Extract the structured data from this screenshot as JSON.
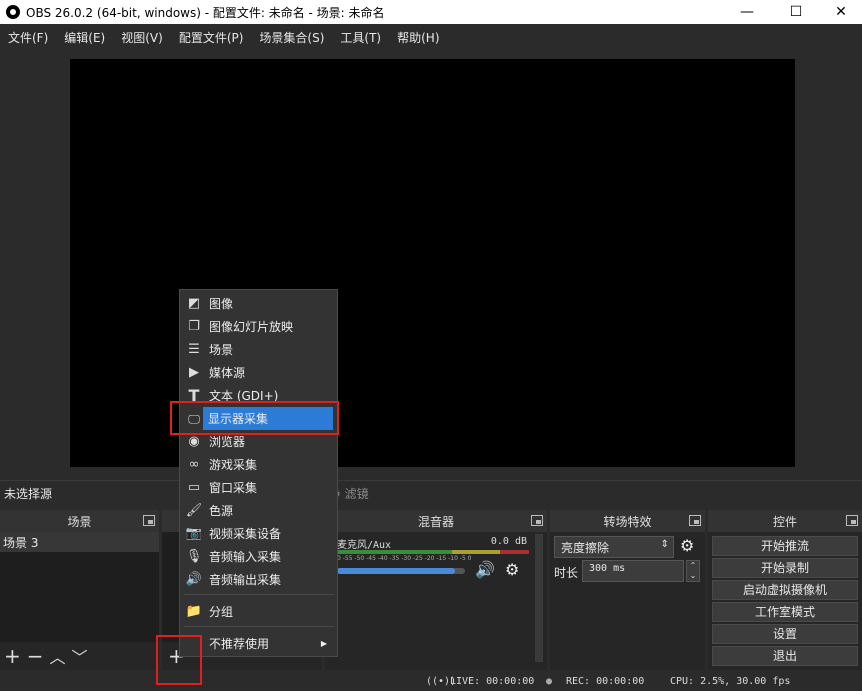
{
  "window": {
    "title": "OBS 26.0.2 (64-bit, windows) - 配置文件: 未命名 - 场景: 未命名",
    "minimize": "—",
    "maximize": "☐",
    "close": "✕"
  },
  "menubar": [
    "文件(F)",
    "编辑(E)",
    "视图(V)",
    "配置文件(P)",
    "场景集合(S)",
    "工具(T)",
    "帮助(H)"
  ],
  "source_label": "未选择源",
  "filters_label": "滤镜",
  "scenes": {
    "title": "场景",
    "items": [
      "场景 3"
    ],
    "add": "+",
    "remove": "−"
  },
  "mixer": {
    "title": "混音器",
    "channel": "麦克风/Aux",
    "db": "0.0 dB",
    "scale": "0 -55 -50 -45 -40 -35 -30 -25 -20 -15 -10 -5 0",
    "volume": 0.92
  },
  "transitions": {
    "title": "转场特效",
    "selected": "亮度擦除",
    "duration_label": "时长",
    "duration_value": "300 ms"
  },
  "controls": {
    "title": "控件",
    "buttons": [
      "开始推流",
      "开始录制",
      "启动虚拟摄像机",
      "工作室模式",
      "设置",
      "退出"
    ]
  },
  "status": {
    "live": "LIVE: 00:00:00",
    "rec": "REC: 00:00:00",
    "cpu": "CPU: 2.5%, 30.00 fps"
  },
  "context_menu": {
    "items": [
      {
        "label": "图像",
        "icon": "image-icon"
      },
      {
        "label": "图像幻灯片放映",
        "icon": "slideshow-icon"
      },
      {
        "label": "场景",
        "icon": "list-icon"
      },
      {
        "label": "媒体源",
        "icon": "play-icon"
      },
      {
        "label": "文本 (GDI+)",
        "icon": "text-icon"
      },
      {
        "label": "显示器采集",
        "icon": "monitor-icon"
      },
      {
        "label": "浏览器",
        "icon": "globe-icon"
      },
      {
        "label": "游戏采集",
        "icon": "gamepad-icon"
      },
      {
        "label": "窗口采集",
        "icon": "window-icon"
      },
      {
        "label": "色源",
        "icon": "brush-icon"
      },
      {
        "label": "视频采集设备",
        "icon": "camera-icon"
      },
      {
        "label": "音频输入采集",
        "icon": "microphone-icon"
      },
      {
        "label": "音频输出采集",
        "icon": "speaker-icon"
      },
      {
        "label": "分组",
        "icon": "folder-icon"
      },
      {
        "label": "不推荐使用",
        "icon": ""
      }
    ],
    "selected": "显示器采集"
  },
  "sources_footer": {
    "add": "+"
  }
}
